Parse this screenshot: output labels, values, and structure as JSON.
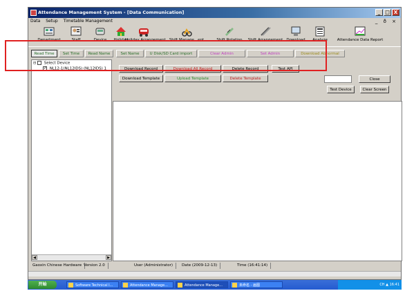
{
  "window": {
    "title": "Attendance Management System - [Data Communication]",
    "buttons": [
      "_",
      "□",
      "X"
    ]
  },
  "menu": {
    "items": [
      "Data",
      "Setup",
      "Timetable Management"
    ],
    "right_controls": "_ ð ×"
  },
  "toolbar": {
    "items": [
      {
        "label": "Department",
        "icon": "department-icon"
      },
      {
        "label": "Staff",
        "icon": "staff-icon"
      },
      {
        "label": "Device",
        "icon": "device-icon"
      },
      {
        "label": "Holiday",
        "icon": "holiday-icon"
      },
      {
        "label": "Holiday Arrangement",
        "icon": "holiday-arrangement-icon"
      },
      {
        "label": "Shift Manage...ent",
        "icon": "shift-management-icon"
      },
      {
        "label": "Shift Rotation",
        "icon": "shift-rotation-icon"
      },
      {
        "label": "Shift Arrangement",
        "icon": "shift-arrangement-icon"
      },
      {
        "label": "Download",
        "icon": "download-icon"
      },
      {
        "label": "Analyze",
        "icon": "analyze-icon"
      },
      {
        "label": "Attendance Data Report",
        "icon": "report-icon"
      }
    ]
  },
  "tabs": [
    {
      "label": "Read Time"
    },
    {
      "label": "Set Time"
    },
    {
      "label": "Read Name"
    },
    {
      "label": "Set Name"
    },
    {
      "label": "U Disk/SD Card import"
    },
    {
      "label": "Clear Admin"
    },
    {
      "label": "Set Admin"
    },
    {
      "label": "Download Abnormal"
    }
  ],
  "tree": {
    "root": "Select Device",
    "device": "NL12-1(NL12IDS)  (NL12IDS)  1"
  },
  "actions": {
    "download_record": "Download Record",
    "download_all_record": "Download All Record",
    "delete_record": "Delete Record",
    "test_api": "Test API",
    "download_template": "Download Template",
    "upload_template": "Upload Template",
    "delete_template": "Delete Template",
    "close": "Close",
    "test_device": "Test Device",
    "clear_screen": "Clear Screen"
  },
  "status": {
    "company": "Gaoxin Chinese Hardware",
    "version": "Version 2.0",
    "user": "User (Administrator)",
    "date": "Date (2009-12-13)",
    "time": "Time (16:41:14)"
  },
  "taskbar": {
    "start": "开始",
    "tasks": [
      "Software Technical I...",
      "Attendance Manage...",
      "Attendance Manage...",
      "未命名 - 画图"
    ],
    "tray": "CH  ▲  16:41"
  }
}
